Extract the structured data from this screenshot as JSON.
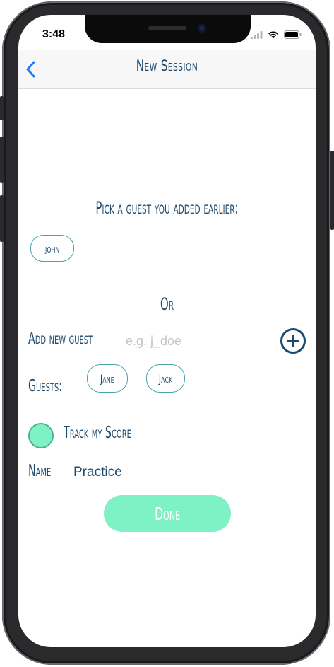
{
  "status_bar": {
    "time": "3:48"
  },
  "nav": {
    "title": "New Session"
  },
  "pick_heading": "Pick a guest you added earlier:",
  "previous_guests": [
    {
      "name": "john"
    }
  ],
  "or_label": "Or",
  "add_guest": {
    "label": "Add new guest",
    "placeholder": "e.g. j_doe",
    "value": ""
  },
  "guests": {
    "label": "Guests:",
    "items": [
      {
        "name": "Jane"
      },
      {
        "name": "Jack"
      }
    ]
  },
  "track_score": {
    "label": "Track my Score",
    "checked": true
  },
  "name_field": {
    "label": "Name",
    "value": "Practice"
  },
  "done_label": "Done",
  "colors": {
    "accent_mint": "#7ef2c5",
    "text_navy": "#1e4a6e",
    "nav_blue": "#1a7cf5",
    "outline_teal": "#4aa3a8"
  }
}
